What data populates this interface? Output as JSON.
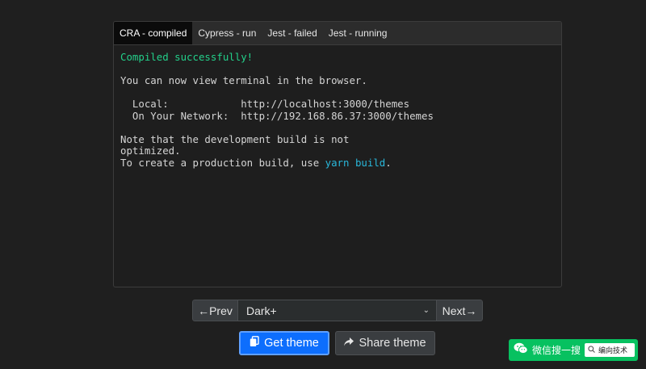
{
  "tabs": [
    {
      "label": "CRA - compiled",
      "active": true
    },
    {
      "label": "Cypress - run",
      "active": false
    },
    {
      "label": "Jest - failed",
      "active": false
    },
    {
      "label": "Jest - running",
      "active": false
    }
  ],
  "terminal": {
    "line1": "Compiled successfully!",
    "line2": "You can now view terminal in the browser.",
    "line3_label": "  Local:            ",
    "line3_value": "http://localhost:3000/themes",
    "line4_label": "  On Your Network:  ",
    "line4_value": "http://192.168.86.37:3000/themes",
    "line5": "Note that the development build is not",
    "line6": "optimized.",
    "line7_prefix": "To create a production build, use ",
    "line7_cmd": "yarn build",
    "line7_suffix": "."
  },
  "theme_bar": {
    "prev_label": "Prev",
    "next_label": "Next",
    "selected_theme": "Dark+"
  },
  "actions": {
    "get_theme_label": "Get theme",
    "share_theme_label": "Share theme"
  },
  "watermark": {
    "brand_text": "微信搜一搜",
    "search_text": "编向技术"
  },
  "colors": {
    "success": "#23d18b",
    "command": "#29b8db",
    "primary": "#0d6efd",
    "wechat": "#07c160"
  }
}
